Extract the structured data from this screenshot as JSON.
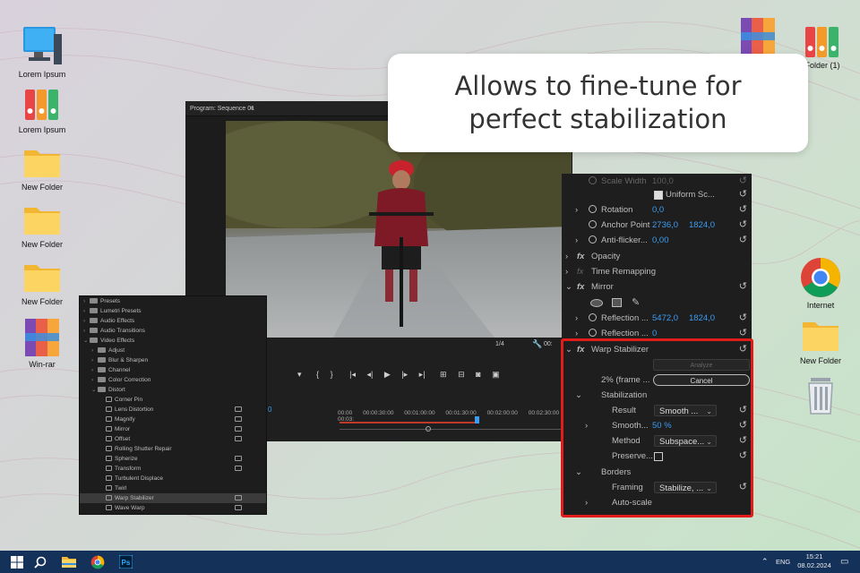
{
  "desktop": {
    "icons": [
      {
        "label": "Lorem Ipsum",
        "icon": "computer-icon"
      },
      {
        "label": "Lorem Ipsum",
        "icon": "winrar-books-icon"
      },
      {
        "label": "New Folder",
        "icon": "folder-icon"
      },
      {
        "label": "New Folder",
        "icon": "folder-icon"
      },
      {
        "label": "New Folder",
        "icon": "folder-icon"
      },
      {
        "label": "Win-rar",
        "icon": "winrar-icon"
      },
      {
        "label": "Folder (1)",
        "icon": "winrar-books-icon"
      },
      {
        "label": "Internet",
        "icon": "chrome-icon"
      },
      {
        "label": "New Folder",
        "icon": "folder-icon"
      }
    ]
  },
  "callout": {
    "line1": "Allows to fine-tune for",
    "line2": "perfect stabilization"
  },
  "program_monitor": {
    "title": "Program: Sequence 01",
    "zoom": "1/4",
    "timecode_partial": "00:",
    "timeline_marks": [
      "00:00",
      "00:00:30:00",
      "00:01:00:00",
      "00:01:30:00",
      "00:02:00:00",
      "00:02:30:00",
      "00:03:"
    ],
    "track_number": "0"
  },
  "effects_panel": {
    "items": [
      {
        "label": "Presets",
        "type": "folder",
        "level": 0
      },
      {
        "label": "Lumetri Presets",
        "type": "folder",
        "level": 0
      },
      {
        "label": "Audio Effects",
        "type": "folder",
        "level": 0
      },
      {
        "label": "Audio Transitions",
        "type": "folder",
        "level": 0
      },
      {
        "label": "Video Effects",
        "type": "folder",
        "level": 0
      },
      {
        "label": "Adjust",
        "type": "folder",
        "level": 1
      },
      {
        "label": "Blur & Sharpen",
        "type": "folder",
        "level": 1
      },
      {
        "label": "Channel",
        "type": "folder",
        "level": 1
      },
      {
        "label": "Color Correction",
        "type": "folder",
        "level": 1
      },
      {
        "label": "Distort",
        "type": "folder",
        "level": 1
      },
      {
        "label": "Corner Pin",
        "type": "effect",
        "level": 2
      },
      {
        "label": "Lens Distortion",
        "type": "effect",
        "level": 2
      },
      {
        "label": "Magnify",
        "type": "effect",
        "level": 2
      },
      {
        "label": "Mirror",
        "type": "effect",
        "level": 2
      },
      {
        "label": "Offset",
        "type": "effect",
        "level": 2
      },
      {
        "label": "Rolling Shutter Repair",
        "type": "effect",
        "level": 2
      },
      {
        "label": "Spherize",
        "type": "effect",
        "level": 2
      },
      {
        "label": "Transform",
        "type": "effect",
        "level": 2
      },
      {
        "label": "Turbulent Displace",
        "type": "effect",
        "level": 2
      },
      {
        "label": "Twirl",
        "type": "effect",
        "level": 2
      },
      {
        "label": "Warp Stabilizer",
        "type": "effect",
        "level": 2
      },
      {
        "label": "Wave Warp",
        "type": "effect",
        "level": 2
      }
    ]
  },
  "effect_controls": {
    "scale_width_label": "Scale Width",
    "scale_width_value": "100,0",
    "uniform_scale_label": "Uniform Sc...",
    "rotation_label": "Rotation",
    "rotation_value": "0,0",
    "anchor_label": "Anchor Point",
    "anchor_x": "2736,0",
    "anchor_y": "1824,0",
    "anti_flicker_label": "Anti-flicker...",
    "anti_flicker_value": "0,00",
    "opacity_label": "Opacity",
    "time_remap_label": "Time Remapping",
    "mirror_label": "Mirror",
    "reflection1_label": "Reflection ...",
    "reflection1_x": "5472,0",
    "reflection1_y": "1824,0",
    "reflection2_label": "Reflection ...",
    "reflection2_value": "0",
    "warp_label": "Warp Stabilizer",
    "analyze_label": "Analyze",
    "frame_status": "2% (frame ...",
    "cancel_label": "Cancel",
    "stabilization_label": "Stabilization",
    "result_label": "Result",
    "result_value": "Smooth ...",
    "smoothness_label": "Smooth...",
    "smoothness_value": "50 %",
    "method_label": "Method",
    "method_value": "Subspace...",
    "preserve_label": "Preserve...",
    "borders_label": "Borders",
    "framing_label": "Framing",
    "framing_value": "Stabilize, ...",
    "autoscale_label": "Auto-scale"
  },
  "taskbar": {
    "lang": "ENG",
    "time": "15:21",
    "date": "08.02.2024"
  },
  "colors": {
    "accent": "#3a9cf2",
    "highlight": "#e21b1b",
    "taskbar": "#14315a"
  }
}
